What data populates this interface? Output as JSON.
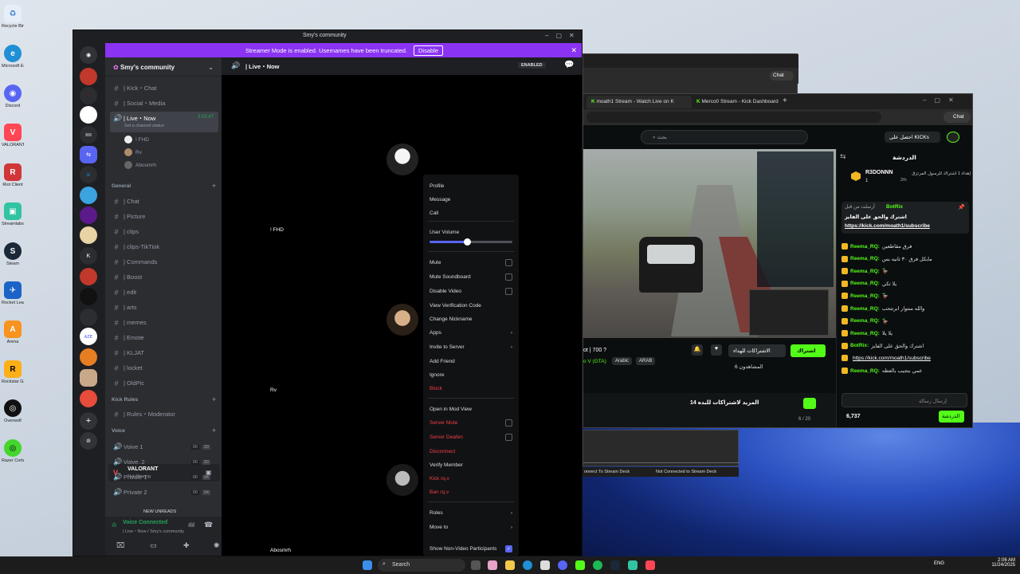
{
  "desktop": {
    "icons": [
      "Recycle Bin",
      "Microsoft Edge",
      "Discord",
      "VALORANT",
      "Riot Client",
      "Streamlabs Desktop",
      "Steam",
      "Rocket League",
      "Arena",
      "Rockstar Games ...",
      "Overwolf",
      "Razer Cortex"
    ]
  },
  "discord": {
    "title": "Smy's community",
    "banner_text": "Streamer Mode is enabled. Usernames have been truncated.",
    "banner_button": "Disable",
    "server_name": "Smy's community",
    "channel_title": "| Live・Now",
    "enabled_badge": "ENABLED",
    "channels_top": [
      {
        "icon": "#",
        "label": "| Kick・Chat"
      },
      {
        "icon": "#",
        "label": "| Social・Media"
      }
    ],
    "live_channel": {
      "label": "| Live・Now",
      "timer": "3:03:47",
      "status": "Set a channel status"
    },
    "voice_users": [
      "! FHD",
      "Rv",
      "Abosmrh"
    ],
    "category_general": "General",
    "general_channels": [
      "| Chat",
      "| Picture",
      "| clips",
      "| clips-TikTiok",
      "| Commands",
      "| Boost",
      "| edit",
      "| arts",
      "| memes",
      "| Emote",
      "| KLJAT",
      "| locket",
      "| OldPic"
    ],
    "category_kick": "Kick Rules",
    "kick_channels": [
      "| Rules・Moderator"
    ],
    "category_voice": "Voice",
    "voice_channels": [
      {
        "label": "Voive 1",
        "a": "00",
        "b": "20"
      },
      {
        "label": "Voive. 2",
        "a": "00",
        "b": "20"
      },
      {
        "label": "Private 1",
        "a": "00",
        "b": "04"
      },
      {
        "label": "Private 2",
        "a": "00",
        "b": "04"
      }
    ],
    "new_unreads": "NEW UNREADS",
    "game_activity": {
      "name": "VALORANT",
      "status": "Not Sharing"
    },
    "voice_connected": {
      "title": "Voice Connected",
      "subtitle": "| Live・Now / Smy's community"
    },
    "tiles": [
      {
        "name": "! FHD",
        "bg": "#ece6df"
      },
      {
        "name": "Rv",
        "bg": "#ede0cf"
      },
      {
        "name": "Abosmrh",
        "bg": "#d6d6d6"
      }
    ],
    "context_menu": {
      "items": [
        "Profile",
        "Message",
        "Call"
      ],
      "volume_label": "User Volume",
      "volume_level": 0.45,
      "toggles": [
        {
          "label": "Mute",
          "checked": false
        },
        {
          "label": "Mute Soundboard",
          "checked": false
        },
        {
          "label": "Disable Video",
          "checked": false
        }
      ],
      "items2": [
        "View Verification Code",
        "Change Nickname"
      ],
      "apps": "Apps",
      "invite": "Invite to Server",
      "items3": [
        "Add Friend",
        "Ignore"
      ],
      "block": "Block",
      "mod_view": "Open in Mod View",
      "server_mute": "Server Mute",
      "server_deafen": "Server Deafen",
      "disconnect": "Disconnect",
      "verify": "Verify Member",
      "kick": "Kick rq.v",
      "ban": "Ban rq.v",
      "roles": "Roles",
      "move_to": "Move to",
      "show_non_video": "Show Non-Video Participants"
    }
  },
  "browser": {
    "back_chat": "Chat",
    "tabs": [
      "moath1 Stream - Watch Live on K",
      "Merco0 Stream - Kick Dashboard"
    ],
    "chat_button": "Chat",
    "search_placeholder": "بحث",
    "get_kicks": "احصل على KICKs",
    "chat_title": "الدردشة",
    "top_gifter": {
      "name": "R3DONNN",
      "note": "إهداء 1 اشتراك للرسول المرتزق",
      "count": "1",
      "time": "2th"
    },
    "pinned": {
      "user": "BotRix",
      "text": "اشترك والحق على الفايز",
      "link": "https://kick.com/moath1/subscribe",
      "meta": "أرسلت من قبل"
    },
    "messages": [
      {
        "user": "Reema_RQ:",
        "text": "فرق مقاطعين"
      },
      {
        "user": "Reema_RQ:",
        "text": "مايكل فرق ٣٠ ثانيه بس"
      },
      {
        "user": "Reema_RQ:",
        "text": "🦆"
      },
      {
        "user": "Reema_RQ:",
        "text": "يلا تكي"
      },
      {
        "user": "Reema_RQ:",
        "text": "🦆"
      },
      {
        "user": "Reema_RQ:",
        "text": "والله منتوار ابرتتحب"
      },
      {
        "user": "Reema_RQ:",
        "text": "🦆"
      },
      {
        "user": "Reema_RQ:",
        "text": "يلا يلا"
      },
      {
        "user": "BotRix:",
        "text": "اشترك والحق على الفايز"
      },
      {
        "user": "",
        "text": "https://kick.com/moath1/subscribe"
      },
      {
        "user": "Reema_RQ:",
        "text": "عمي بتجيب بالعطه"
      }
    ],
    "chat_input_placeholder": "إرسال رسالة",
    "points": "6,737",
    "chat_send": "الدردشة",
    "stream_title_snip": "ot | 700 ?",
    "stream_game": "o V (GTA)",
    "tags": [
      "Arabic",
      "ARAB"
    ],
    "sub_button": "الاشتراكات للهداء",
    "follow_button": "اشتراك",
    "viewers": "المشاهدون 6",
    "promo": "المزيد لاشتراكات للبده 14",
    "promo_count": "6 / 20",
    "deck_left": "onnect To Stream Deck",
    "deck_right": "Not Connected to Stream Deck"
  },
  "taskbar": {
    "search": "Search",
    "lang": "ENG",
    "time": "2:06 AM",
    "date": "11/24/2025"
  }
}
